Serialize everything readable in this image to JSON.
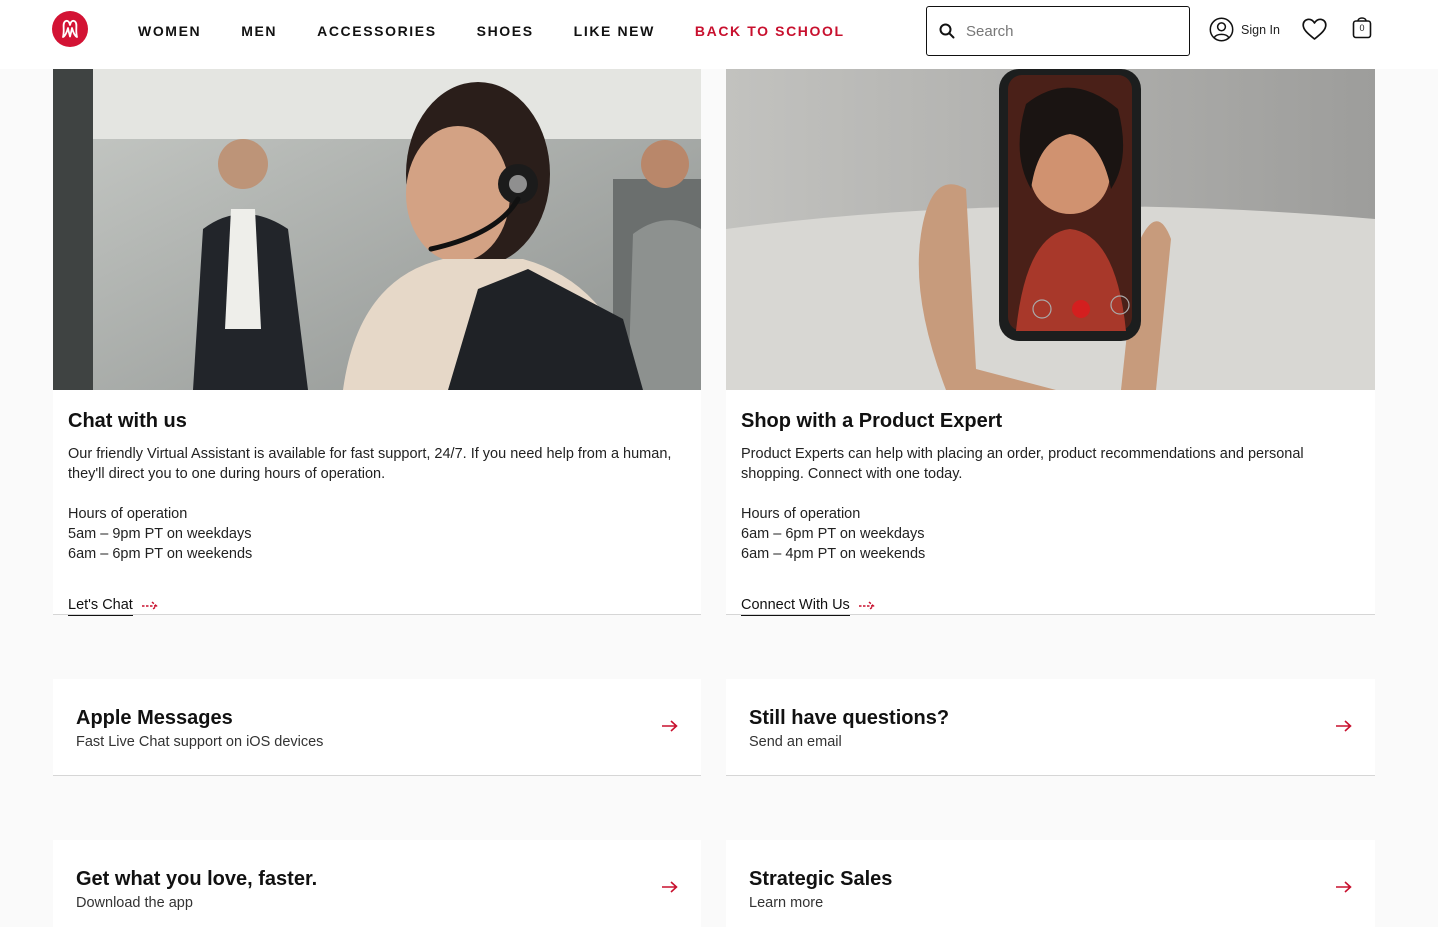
{
  "header": {
    "nav": [
      {
        "label": "WOMEN"
      },
      {
        "label": "MEN"
      },
      {
        "label": "ACCESSORIES"
      },
      {
        "label": "SHOES"
      },
      {
        "label": "LIKE NEW"
      },
      {
        "label": "BACK TO SCHOOL"
      }
    ],
    "search_placeholder": "Search",
    "sign_in": "Sign In",
    "bag_count": "0"
  },
  "cards": [
    {
      "title": "Chat with us",
      "description": "Our friendly Virtual Assistant is available for fast support, 24/7. If you need help from a human, they'll direct you to one during hours of operation.",
      "hours_heading": "Hours of operation",
      "hours_weekdays": "5am – 9pm PT on weekdays",
      "hours_weekends": "6am – 6pm PT on weekends",
      "cta": "Let's Chat"
    },
    {
      "title": "Shop with a Product Expert",
      "description": "Product Experts can help with placing an order, product recommendations and personal shopping. Connect with one today.",
      "hours_heading": "Hours of operation",
      "hours_weekdays": "6am – 6pm PT on weekdays",
      "hours_weekends": "6am – 4pm PT on weekends",
      "cta": "Connect With Us"
    }
  ],
  "links": [
    {
      "title": "Apple Messages",
      "subtitle": "Fast Live Chat support on iOS devices"
    },
    {
      "title": "Still have questions?",
      "subtitle": "Send an email"
    },
    {
      "title": "Get what you love, faster.",
      "subtitle": "Download the app"
    },
    {
      "title": "Strategic Sales",
      "subtitle": "Learn more"
    }
  ],
  "colors": {
    "brand_red": "#d31334",
    "accent_red": "#c8102e",
    "page_bg": "#fafafa"
  }
}
